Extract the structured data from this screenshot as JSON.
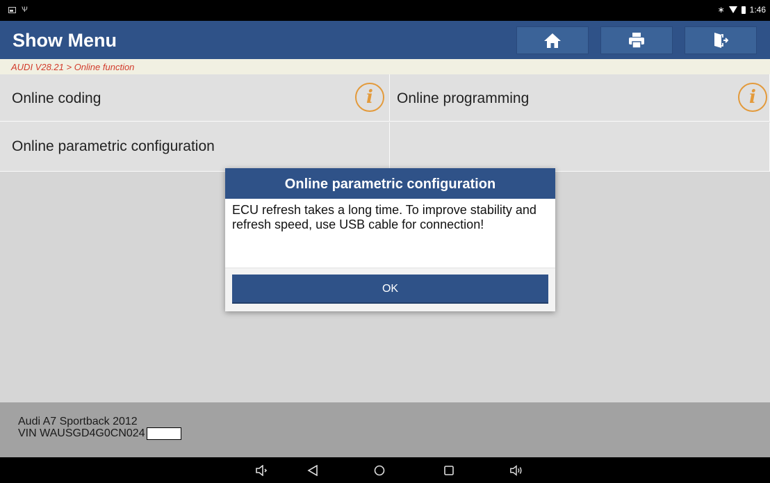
{
  "status_bar": {
    "time": "1:46"
  },
  "header": {
    "title": "Show Menu"
  },
  "breadcrumb": "AUDI V28.21 > Online function",
  "menu": {
    "items": [
      {
        "label": "Online coding"
      },
      {
        "label": "Online programming"
      },
      {
        "label": "Online parametric configuration"
      }
    ],
    "info_symbol": "i"
  },
  "dialog": {
    "title": "Online parametric configuration",
    "message": "ECU refresh takes a long time. To improve stability and refresh speed, use USB cable for connection!",
    "ok_label": "OK"
  },
  "vehicle": {
    "model": "Audi A7 Sportback 2012",
    "vin": "VIN WAUSGD4G0CN024"
  },
  "colors": {
    "header": "#2f5288",
    "breadcrumb_text": "#d23a2a",
    "info_icon": "#e39a3b"
  },
  "icons": [
    "home-icon",
    "print-icon",
    "exit-icon",
    "info-icon",
    "volume-down-icon",
    "back-icon",
    "home-circle-icon",
    "recents-icon",
    "volume-up-icon"
  ]
}
